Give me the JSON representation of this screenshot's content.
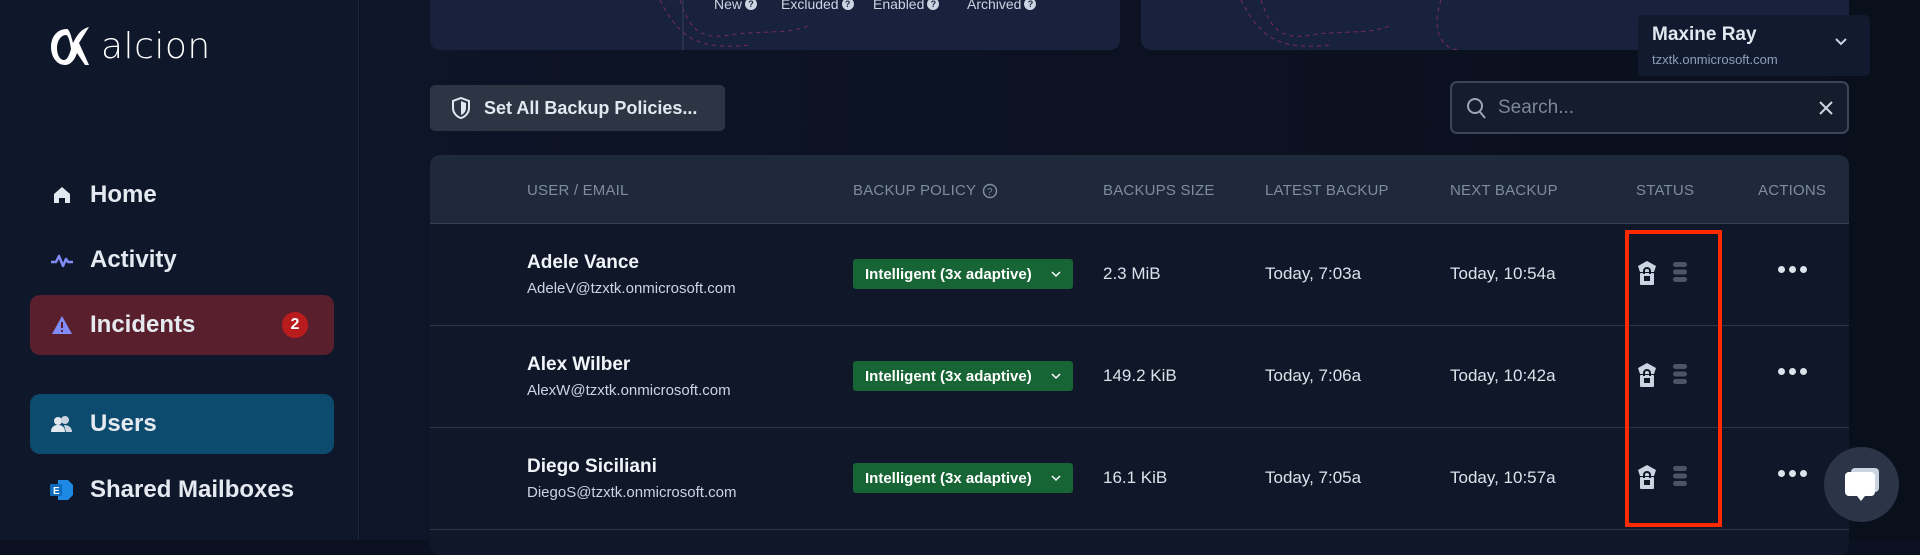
{
  "brand": {
    "name": "alcion"
  },
  "sidebar": {
    "items": [
      {
        "label": "Home",
        "icon": "home-icon"
      },
      {
        "label": "Activity",
        "icon": "activity-icon"
      },
      {
        "label": "Incidents",
        "icon": "warning-icon",
        "badge": "2"
      },
      {
        "label": "Users",
        "icon": "users-icon",
        "active": true
      },
      {
        "label": "Shared Mailboxes",
        "icon": "exchange-icon"
      }
    ]
  },
  "stats": {
    "labels": [
      "New",
      "Excluded",
      "Enabled",
      "Archived"
    ]
  },
  "toolbar": {
    "set_policies_label": "Set All Backup Policies...",
    "search_placeholder": "Search...",
    "search_value": ""
  },
  "account": {
    "name": "Maxine Ray",
    "tenant": "tzxtk.onmicrosoft.com"
  },
  "table": {
    "columns": [
      "USER / EMAIL",
      "BACKUP POLICY",
      "BACKUPS SIZE",
      "LATEST BACKUP",
      "NEXT BACKUP",
      "STATUS",
      "ACTIONS"
    ],
    "rows": [
      {
        "name": "Adele Vance",
        "email": "AdeleV@tzxtk.onmicrosoft.com",
        "policy": "Intelligent (3x adaptive)",
        "size": "2.3 MiB",
        "latest": "Today, 7:03a",
        "next": "Today, 10:54a"
      },
      {
        "name": "Alex Wilber",
        "email": "AlexW@tzxtk.onmicrosoft.com",
        "policy": "Intelligent (3x adaptive)",
        "size": "149.2 KiB",
        "latest": "Today, 7:06a",
        "next": "Today, 10:42a"
      },
      {
        "name": "Diego Siciliani",
        "email": "DiegoS@tzxtk.onmicrosoft.com",
        "policy": "Intelligent (3x adaptive)",
        "size": "16.1 KiB",
        "latest": "Today, 7:05a",
        "next": "Today, 10:57a"
      }
    ]
  },
  "colors": {
    "highlight": "#ff2a00",
    "policy_pill": "#176534",
    "incidents_bg": "#5a1f2c",
    "users_bg": "#0c4a6e",
    "badge": "#b91c1c"
  }
}
